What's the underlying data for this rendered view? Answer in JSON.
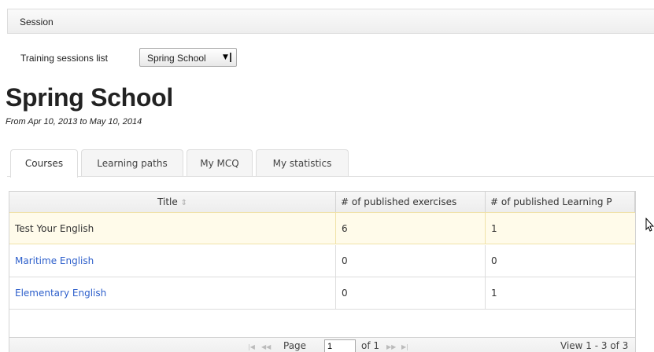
{
  "session_bar": {
    "label": "Session"
  },
  "session_select": {
    "label": "Training sessions list",
    "value": "Spring School"
  },
  "page_title": "Spring School",
  "date_range": "From Apr 10, 2013 to May 10, 2014",
  "tabs": [
    "Courses",
    "Learning paths",
    "My MCQ",
    "My statistics"
  ],
  "table": {
    "columns": [
      "Title",
      "# of published exercises",
      "# of published Learning P"
    ],
    "rows": [
      {
        "title": "Test Your English",
        "exercises": "6",
        "paths": "1"
      },
      {
        "title": "Maritime English",
        "exercises": "0",
        "paths": "0"
      },
      {
        "title": "Elementary English",
        "exercises": "0",
        "paths": "1"
      }
    ]
  },
  "pager": {
    "page_label": "Page",
    "page_value": "1",
    "of_label": "of 1",
    "view_label": "View 1 - 3 of 3"
  },
  "icons": {
    "sort": "sort-arrows-icon",
    "cursor": "mouse-cursor-icon"
  }
}
